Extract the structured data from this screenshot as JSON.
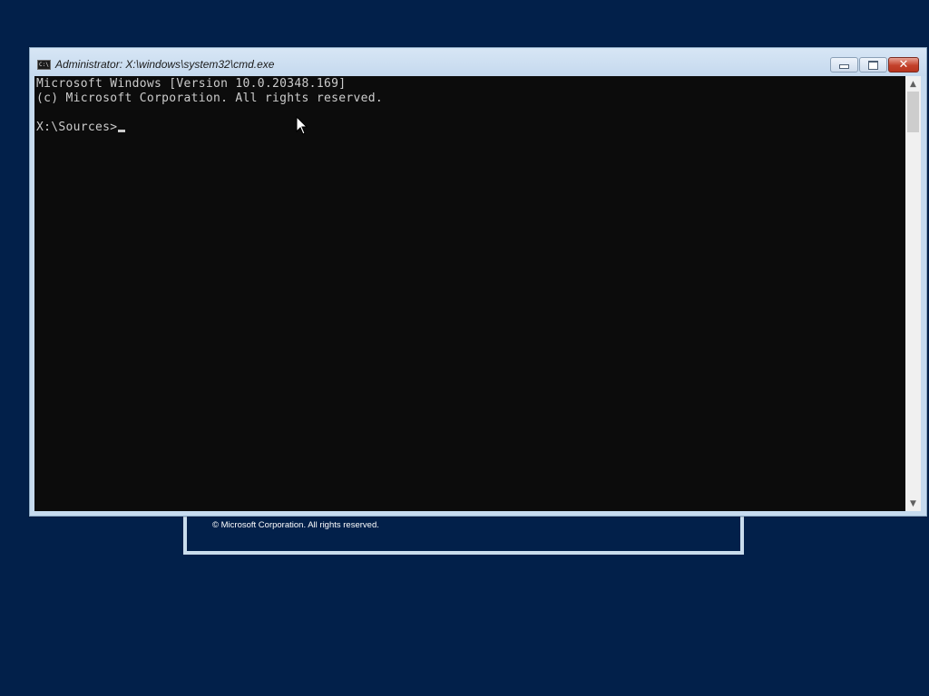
{
  "window": {
    "title": "Administrator: X:\\windows\\system32\\cmd.exe",
    "icon_label": "C:\\",
    "close_glyph": "✕"
  },
  "console": {
    "lines": [
      "Microsoft Windows [Version 10.0.20348.169]",
      "(c) Microsoft Corporation. All rights reserved.",
      "",
      "X:\\Sources>"
    ]
  },
  "background_window": {
    "copyright": "© Microsoft Corporation. All rights reserved."
  },
  "scrollbar": {
    "up_arrow": "▲",
    "down_arrow": "▼"
  },
  "colors": {
    "desktop": "#02204a",
    "console_bg": "#0c0c0c",
    "console_text": "#cccccc",
    "title_bar": "#c6dbef",
    "close_button": "#c3412b"
  }
}
